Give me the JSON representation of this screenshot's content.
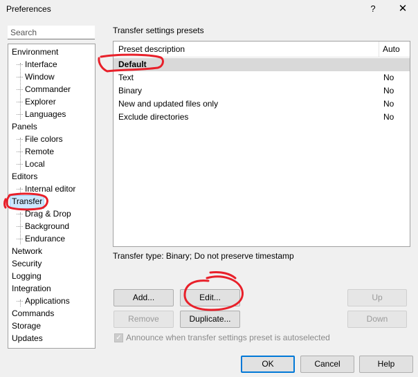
{
  "window": {
    "title": "Preferences",
    "help_glyph": "?",
    "close_glyph": "✕"
  },
  "search": {
    "placeholder": "Search"
  },
  "tree": {
    "items": [
      {
        "label": "Environment"
      },
      {
        "label": "Interface"
      },
      {
        "label": "Window"
      },
      {
        "label": "Commander"
      },
      {
        "label": "Explorer"
      },
      {
        "label": "Languages"
      },
      {
        "label": "Panels"
      },
      {
        "label": "File colors"
      },
      {
        "label": "Remote"
      },
      {
        "label": "Local"
      },
      {
        "label": "Editors"
      },
      {
        "label": "Internal editor"
      },
      {
        "label": "Transfer"
      },
      {
        "label": "Drag & Drop"
      },
      {
        "label": "Background"
      },
      {
        "label": "Endurance"
      },
      {
        "label": "Network"
      },
      {
        "label": "Security"
      },
      {
        "label": "Logging"
      },
      {
        "label": "Integration"
      },
      {
        "label": "Applications"
      },
      {
        "label": "Commands"
      },
      {
        "label": "Storage"
      },
      {
        "label": "Updates"
      }
    ],
    "selected": "Transfer"
  },
  "presets": {
    "group_title": "Transfer settings presets",
    "columns": {
      "description": "Preset description",
      "auto": "Auto"
    },
    "rows": [
      {
        "description": "Default",
        "auto": ""
      },
      {
        "description": "Text",
        "auto": "No"
      },
      {
        "description": "Binary",
        "auto": "No"
      },
      {
        "description": "New and updated files only",
        "auto": "No"
      },
      {
        "description": "Exclude directories",
        "auto": "No"
      }
    ],
    "selected_row": "Default",
    "transfer_type": "Transfer type: Binary; Do not preserve timestamp"
  },
  "buttons": {
    "add": "Add...",
    "edit": "Edit...",
    "up": "Up",
    "remove": "Remove",
    "duplicate": "Duplicate...",
    "down": "Down",
    "ok": "OK",
    "cancel": "Cancel",
    "help": "Help"
  },
  "autoselect": {
    "label": "Announce when transfer settings preset is autoselected",
    "checked": true,
    "enabled": false
  },
  "colors": {
    "selection": "#cce8ff",
    "annotation": "#e8202a",
    "default_button_border": "#0078d7"
  }
}
